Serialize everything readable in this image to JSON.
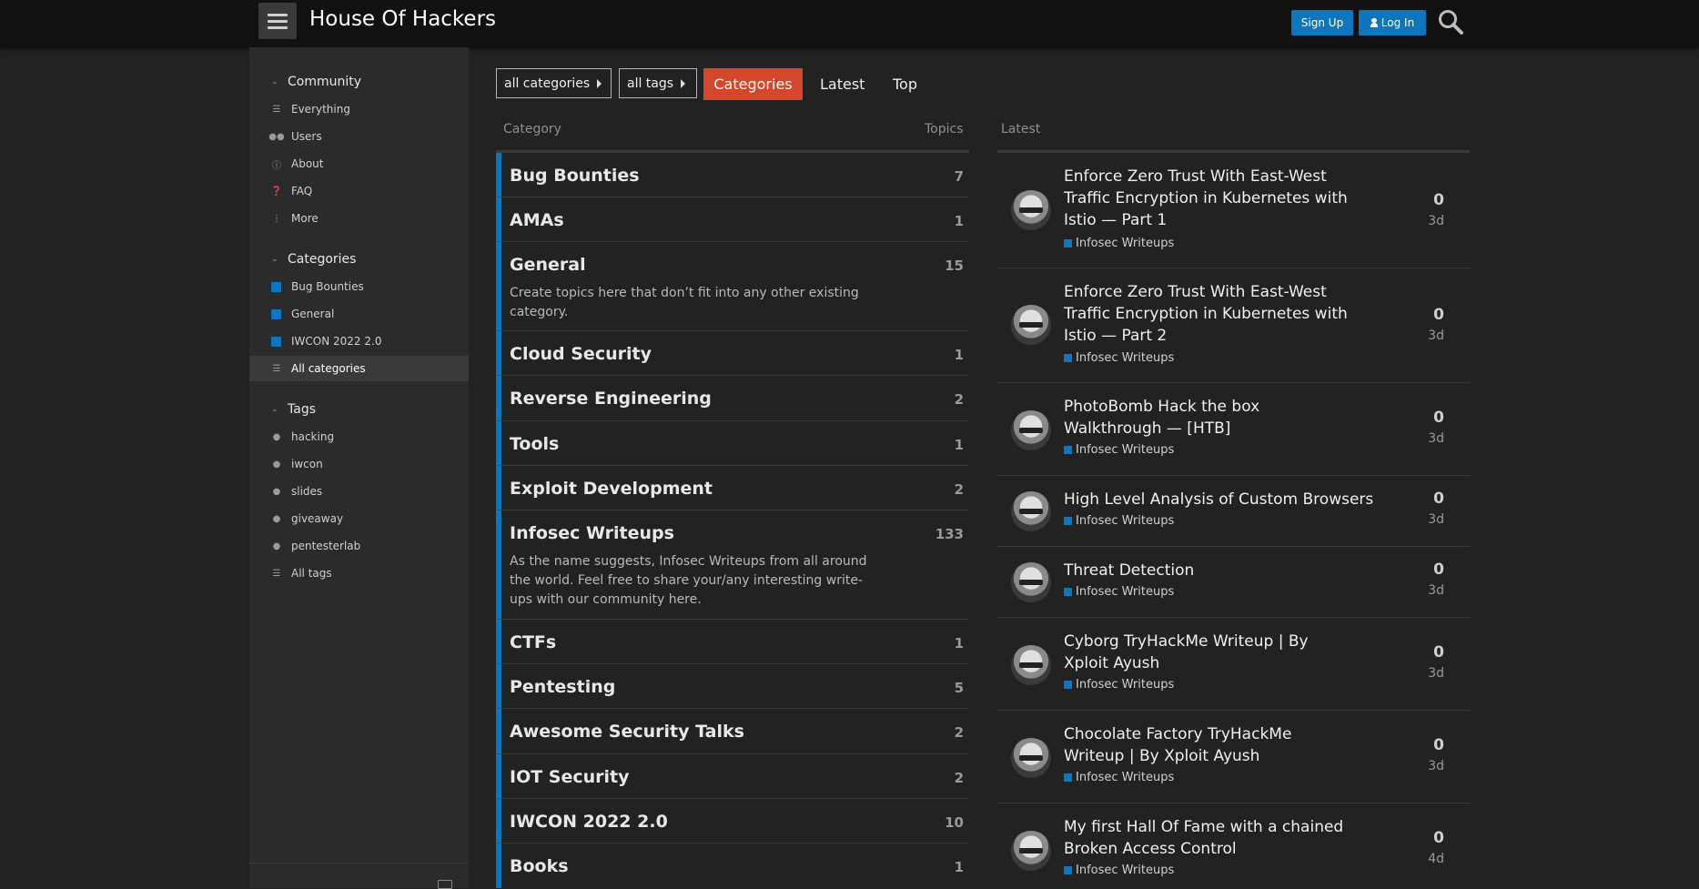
{
  "header": {
    "site_title": "House Of Hackers",
    "signup_label": "Sign Up",
    "login_label": "Log In"
  },
  "sidebar": {
    "community": {
      "title": "Community",
      "items": [
        {
          "label": "Everything",
          "icon": "layers-icon"
        },
        {
          "label": "Users",
          "icon": "users-icon"
        },
        {
          "label": "About",
          "icon": "info-icon"
        },
        {
          "label": "FAQ",
          "icon": "question-icon"
        },
        {
          "label": "More",
          "icon": "more-vertical-icon"
        }
      ]
    },
    "categories": {
      "title": "Categories",
      "items": [
        {
          "label": "Bug Bounties"
        },
        {
          "label": "General"
        },
        {
          "label": "IWCON 2022 2.0"
        },
        {
          "label": "All categories"
        }
      ]
    },
    "tags": {
      "title": "Tags",
      "items": [
        {
          "label": "hacking"
        },
        {
          "label": "iwcon"
        },
        {
          "label": "slides"
        },
        {
          "label": "giveaway"
        },
        {
          "label": "pentesterlab"
        },
        {
          "label": "All tags"
        }
      ]
    }
  },
  "nav": {
    "all_categories": "all categories",
    "all_tags": "all tags",
    "tabs": [
      "Categories",
      "Latest",
      "Top"
    ]
  },
  "categories_table": {
    "header_category": "Category",
    "header_topics": "Topics",
    "rows": [
      {
        "name": "Bug Bounties",
        "topics": "7",
        "description": ""
      },
      {
        "name": "AMAs",
        "topics": "1",
        "description": ""
      },
      {
        "name": "General",
        "topics": "15",
        "description": "Create topics here that don’t fit into any other existing category."
      },
      {
        "name": "Cloud Security",
        "topics": "1",
        "description": ""
      },
      {
        "name": "Reverse Engineering",
        "topics": "2",
        "description": ""
      },
      {
        "name": "Tools",
        "topics": "1",
        "description": ""
      },
      {
        "name": "Exploit Development",
        "topics": "2",
        "description": ""
      },
      {
        "name": "Infosec Writeups",
        "topics": "133",
        "description": "As the name suggests, Infosec Writeups from all around the world. Feel free to share your/any interesting write-ups with our community here."
      },
      {
        "name": "CTFs",
        "topics": "1",
        "description": ""
      },
      {
        "name": "Pentesting",
        "topics": "5",
        "description": ""
      },
      {
        "name": "Awesome Security Talks",
        "topics": "2",
        "description": ""
      },
      {
        "name": "IOT Security",
        "topics": "2",
        "description": ""
      },
      {
        "name": "IWCON 2022 2.0",
        "topics": "10",
        "description": ""
      },
      {
        "name": "Books",
        "topics": "1",
        "description": ""
      }
    ]
  },
  "latest": {
    "header": "Latest",
    "topics": [
      {
        "title": "Enforce Zero Trust With East-West Traffic Encryption in Kubernetes with Istio — Part 1",
        "category": "Infosec Writeups",
        "posts": "0",
        "age": "3d"
      },
      {
        "title": "Enforce Zero Trust With East-West Traffic Encryption in Kubernetes with Istio — Part 2",
        "category": "Infosec Writeups",
        "posts": "0",
        "age": "3d"
      },
      {
        "title": "PhotoBomb Hack the box Walkthrough — [HTB]",
        "category": "Infosec Writeups",
        "posts": "0",
        "age": "3d"
      },
      {
        "title": "High Level Analysis of Custom Browsers",
        "category": "Infosec Writeups",
        "posts": "0",
        "age": "3d"
      },
      {
        "title": "Threat Detection",
        "category": "Infosec Writeups",
        "posts": "0",
        "age": "3d"
      },
      {
        "title": "Cyborg TryHackMe Writeup | By Xploit Ayush",
        "category": "Infosec Writeups",
        "posts": "0",
        "age": "3d"
      },
      {
        "title": "Chocolate Factory TryHackMe Writeup | By Xploit Ayush",
        "category": "Infosec Writeups",
        "posts": "0",
        "age": "3d"
      },
      {
        "title": "My first Hall Of Fame with a chained Broken Access Control",
        "category": "Infosec Writeups",
        "posts": "0",
        "age": "4d"
      }
    ]
  },
  "colors": {
    "category_accent": "#0e76bd",
    "active_tab": "#d4472c",
    "primary_button": "#0e76bd"
  }
}
